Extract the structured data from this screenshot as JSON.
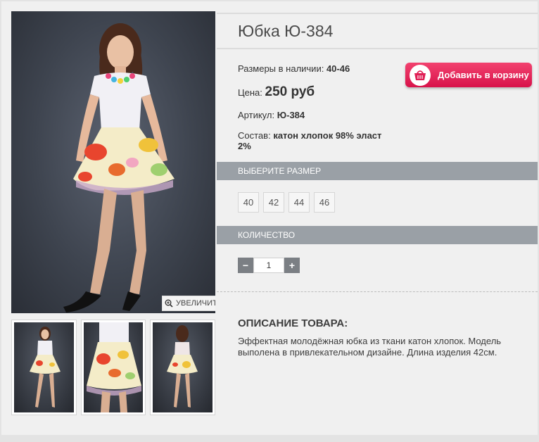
{
  "product": {
    "title": "Юбка Ю-384",
    "sizes_label": "Размеры в наличии:",
    "sizes_value": "40-46",
    "price_label": "Цена:",
    "price_value": "250 руб",
    "sku_label": "Артикул:",
    "sku_value": "Ю-384",
    "composition_label": "Состав:",
    "composition_value": "катон хлопок 98% эласт 2%"
  },
  "gallery": {
    "zoom_label": "УВЕЛИЧИТЬ",
    "thumbnail_count": 3
  },
  "cart": {
    "add_label": "Добавить в корзину"
  },
  "size_section": {
    "heading": "ВЫБЕРИТЕ РАЗМЕР",
    "options": [
      "40",
      "42",
      "44",
      "46"
    ]
  },
  "quantity_section": {
    "heading": "КОЛИЧЕСТВО",
    "minus": "−",
    "plus": "+",
    "value": "1"
  },
  "description": {
    "heading": "ОПИСАНИЕ ТОВАРА:",
    "text": "Эффектная молодёжная юбка из ткани катон хлопок. Модель выполена в привлекательном дизайне. Длина изделия 42см."
  },
  "colors": {
    "accent_button": "#e01e55",
    "section_bar": "#9aa0a6",
    "qty_button": "#7b7f84"
  }
}
